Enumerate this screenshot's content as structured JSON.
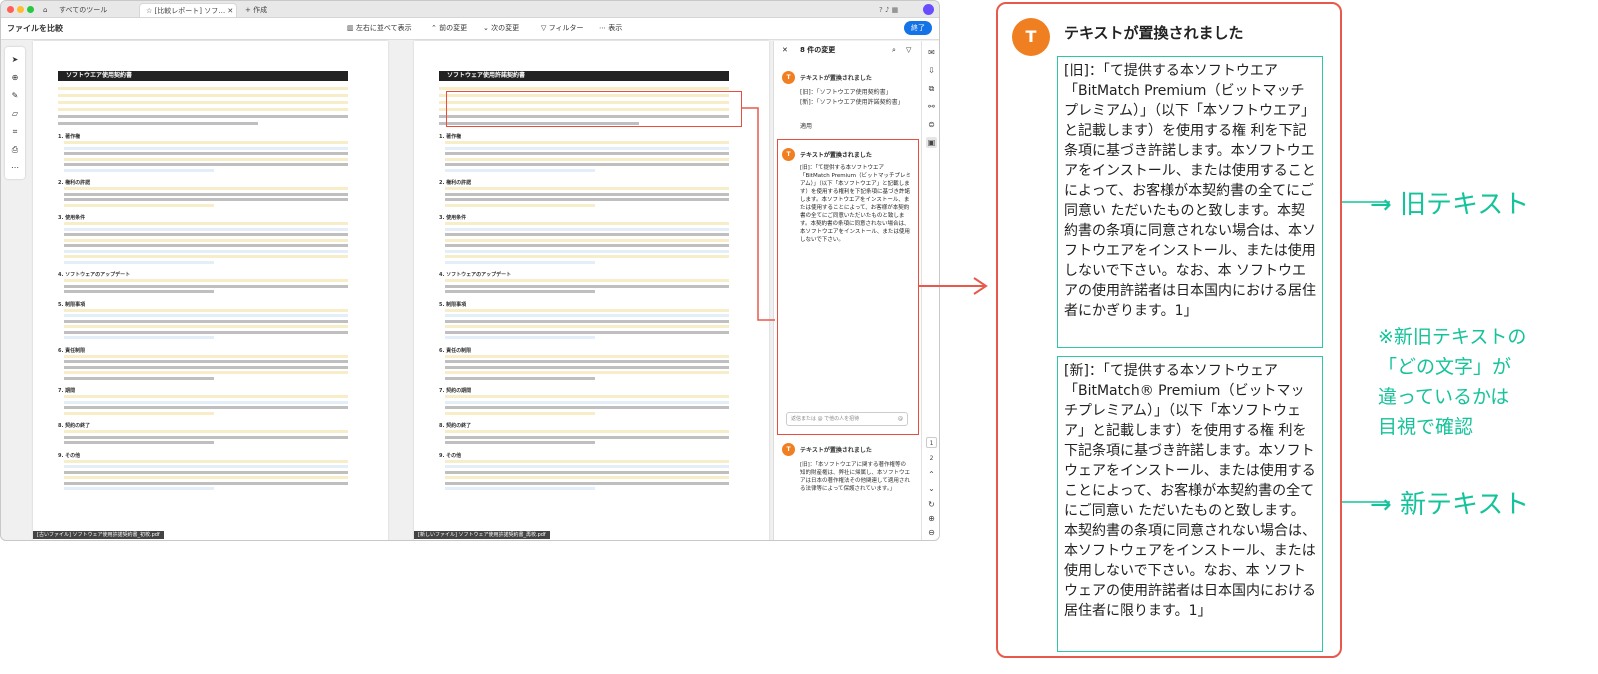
{
  "browser": {
    "tabs": [
      {
        "label": "すべてのツール"
      },
      {
        "label": "[比較レポート] ソフ…"
      },
      {
        "label": "+ 作成"
      }
    ]
  },
  "toolbar": {
    "title": "ファイルを比較",
    "side_by_side": "左右に並べて表示",
    "prev": "前の変更",
    "next": "次の変更",
    "filter": "フィルター",
    "view": "表示",
    "done": "終了"
  },
  "docs": {
    "old_title": "ソフトウエア使用契約書",
    "new_title": "ソフトウェア使用許諾契約書",
    "old_footer": "[古いファイル] ソフトウェア使用許諾契約書_初校.pdf",
    "new_footer": "[新しいファイル] ソフトウェア使用許諾契約書_再校.pdf",
    "sections_old": [
      "1. 著作権",
      "2. 権利の許諾",
      "3. 使用条件",
      "4. ソフトウェアのアップデート",
      "5. 制限事項",
      "6. 責任制限",
      "7. 期間",
      "8. 契約の終了",
      "9. その他"
    ],
    "sections_new": [
      "1. 著作権",
      "2. 権利の許諾",
      "3. 使用条件",
      "4. ソフトウェアのアップデート",
      "5. 制限事項",
      "6. 責任の制限",
      "7. 契約の期間",
      "8. 契約の終了",
      "9. その他"
    ]
  },
  "panel": {
    "header": "8 件の変更",
    "item1_title": "テキストが置換されました",
    "item1_old": "[旧]：「ソフトウエア使用契約書」",
    "item1_new": "[新]：「ソフトウエア使用許諾契約書」",
    "item1_note": "適用",
    "item2_title": "テキストが置換されました",
    "item2_text": "[旧]：「て提供する本ソフトウエア「BitMatch Premium（ビットマッチプレミアム）」（以下「本ソフトウエア」と記載します）を使用する権利を下記条項に基づき許諾します。本ソフトウエアをインストール、または使用することによって、お客様が本契約書の全てにご同意いただいたものと致します。本契約書の条項に同意されない場合は、本ソフトウエアをインストール、または使用しないで下さい。",
    "comment_placeholder": "返信または @ で他の人を招待",
    "item3_title": "テキストが置換されました",
    "item3_text": "[旧]：「本ソフトウエアに関する著作権等の知的財産権は、弊社に帰属し、本ソフトウエアは日本の著作権法その他関連して適用される法律等によって保護されています。」"
  },
  "rail": {
    "page_current": "1",
    "page_total": "2"
  },
  "card": {
    "icon": "T",
    "title": "テキストが置換されました",
    "old_text": "[旧]：「て提供する本ソフトウエア「BitMatch Premium（ビットマッチプレミアム）」（以下「本ソフトウエア」と記載します）を使用する権 利を下記条項に基づき許諾します。本ソフトウエアをインストール、または使用することによって、お客様が本契約書の全てにご同意い ただいたものと致します。本契約書の条項に同意されない場合は、本ソフトウエアをインストール、または使用しないで下さい。なお、本 ソフトウエアの使用許諾者は日本国内における居住者にかぎります。1」",
    "new_text": "[新]：「て提供する本ソフトウェア「BitMatch® Premium（ビットマッチプレミアム）」（以下「本ソフトウェア」と記載します）を使用する権 利を下記条項に基づき許諾します。本ソフトウェアをインストール、または使用することによって、お客様が本契約書の全てにご同意い ただいたものと致します。本契約書の条項に同意されない場合は、本ソフトウェアをインストール、または使用しないで下さい。なお、本 ソフトウェアの使用許諾者は日本国内における居住者に限ります。1」"
  },
  "annotations": {
    "old_label": "→ 旧テキスト",
    "new_label": "→ 新テキスト",
    "note": "※新旧テキストの\n「どの文字」が\n違っているかは\n目視で確認"
  },
  "colors": {
    "accent_red": "#e8594c",
    "accent_green": "#14c39a",
    "icon_orange": "#f07f22",
    "done_blue": "#1473e6"
  }
}
